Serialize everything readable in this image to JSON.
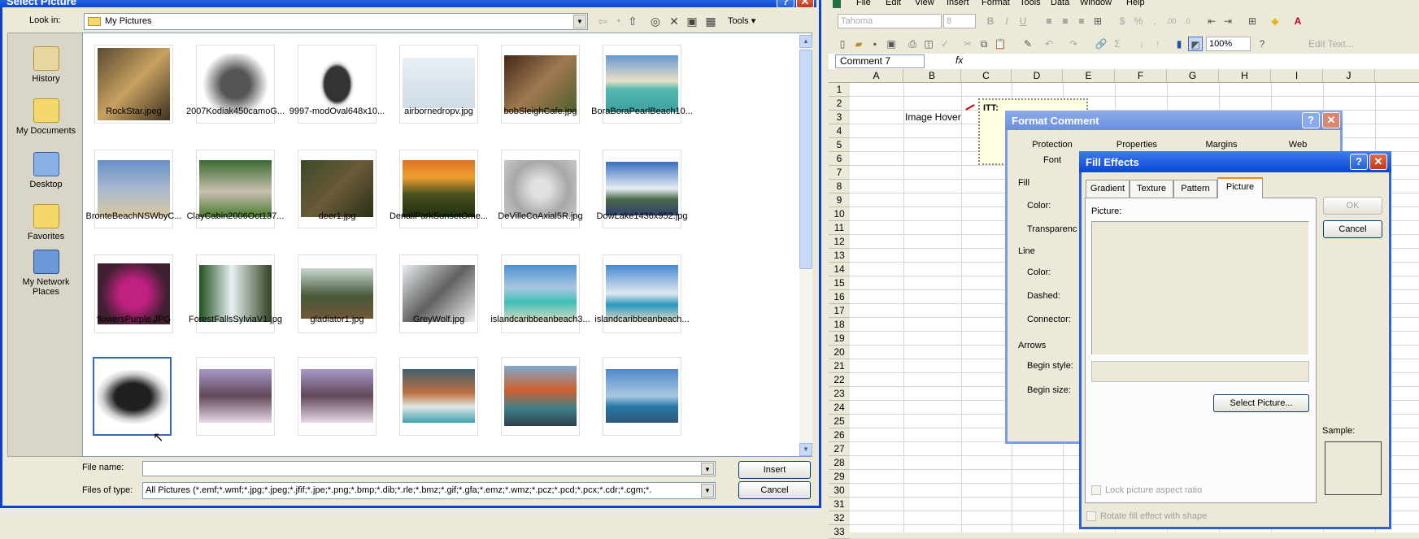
{
  "select_picture": {
    "title": "Select Picture",
    "lookin_label": "Look in:",
    "lookin_value": "My Pictures",
    "tools_label": "Tools",
    "places": [
      "History",
      "My Documents",
      "Desktop",
      "Favorites",
      "My Network Places"
    ],
    "files": [
      "RockStar.jpeg",
      "2007Kodiak450camoG...",
      "9997-modOval648x10...",
      "airbornedropv.jpg",
      "bobSleighCafe.jpg",
      "BoraBoraPearlBeach10...",
      "BronteBeachNSWbyC...",
      "ClayCabin2006Oct137...",
      "deer1.jpg",
      "DenaliParkSunsetOme...",
      "DeVilleCoAxial5R.jpg",
      "DowLake1436x952.jpg",
      "flowersPurple.JPG",
      "ForestFallsSylviaV1.jpg",
      "gladiator1.jpg",
      "GreyWolf.jpg",
      "islandcaribbeanbeach3...",
      "islandcaribbeanbeach..."
    ],
    "filename_label": "File name:",
    "filename_value": "",
    "filetype_label": "Files of type:",
    "filetype_value": "All Pictures (*.emf;*.wmf;*.jpg;*.jpeg;*.jfif;*.jpe;*.png;*.bmp;*.dib;*.rle;*.bmz;*.gif;*.gfa;*.emz;*.wmz;*.pcz;*.pcd;*.pcx;*.cdr;*.cgm;*.",
    "insert_label": "Insert",
    "cancel_label": "Cancel"
  },
  "excel": {
    "menu": [
      "File",
      "Edit",
      "View",
      "Insert",
      "Format",
      "Tools",
      "Data",
      "Window",
      "Help"
    ],
    "font_name": "Tahoma",
    "font_size": "8",
    "zoom": "100%",
    "edit_text": "Edit Text...",
    "namebox": "Comment 7",
    "fx": "fx",
    "columns": [
      "A",
      "B",
      "C",
      "D",
      "E",
      "F",
      "G",
      "H",
      "I",
      "J"
    ],
    "rows": [
      "1",
      "2",
      "3",
      "4",
      "5",
      "6",
      "7",
      "8",
      "9",
      "10",
      "11",
      "12",
      "13",
      "14",
      "15",
      "16",
      "17",
      "18",
      "19",
      "20",
      "21",
      "22",
      "23",
      "24",
      "25",
      "26",
      "27",
      "28",
      "29",
      "30",
      "31",
      "32",
      "33"
    ],
    "cell_b3": "Image Hover",
    "comment_text": "ITT:"
  },
  "format_comment": {
    "title": "Format Comment",
    "tabs": [
      "Protection",
      "Properties",
      "Margins",
      "Web",
      "Font"
    ],
    "fill_label": "Fill",
    "color_label": "Color:",
    "transparency_label": "Transparenc",
    "line_label": "Line",
    "line_color_label": "Color:",
    "dashed_label": "Dashed:",
    "connector_label": "Connector:",
    "arrows_label": "Arrows",
    "begin_style_label": "Begin style:",
    "begin_size_label": "Begin size:"
  },
  "fill_effects": {
    "title": "Fill Effects",
    "tabs": [
      "Gradient",
      "Texture",
      "Pattern",
      "Picture"
    ],
    "picture_label": "Picture:",
    "select_picture_label": "Select Picture...",
    "ok_label": "OK",
    "cancel_label": "Cancel",
    "sample_label": "Sample:",
    "lock_aspect_label": "Lock picture aspect ratio",
    "rotate_label": "Rotate fill effect with shape"
  }
}
